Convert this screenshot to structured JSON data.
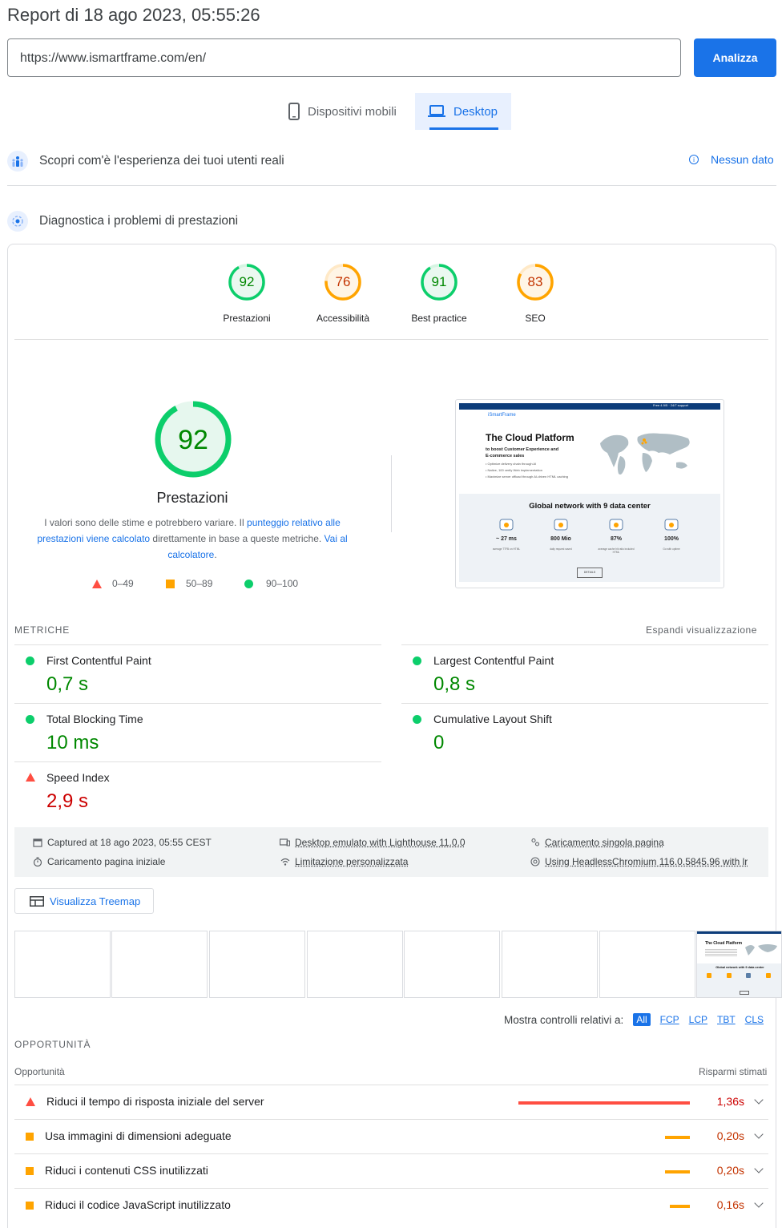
{
  "header": {
    "title": "Report di 18 ago 2023, 05:55:26",
    "url_value": "https://www.ismartframe.com/en/",
    "analyze_label": "Analizza"
  },
  "tabs": [
    {
      "label": "Dispositivi mobili",
      "icon": "phone-icon",
      "active": false
    },
    {
      "label": "Desktop",
      "icon": "laptop-icon",
      "active": true
    }
  ],
  "field_section": {
    "label": "Scopri com'è l'esperienza dei tuoi utenti reali",
    "status": "Nessun dato"
  },
  "lab_section": {
    "label": "Diagnostica i problemi di prestazioni"
  },
  "categories": [
    {
      "score": "92",
      "label": "Prestazioni",
      "level": 0.92,
      "color": "#0cce6b",
      "text_color": "#008800"
    },
    {
      "score": "76",
      "label": "Accessibilità",
      "level": 0.76,
      "color": "#ffa400",
      "text_color": "#c33300"
    },
    {
      "score": "91",
      "label": "Best practice",
      "level": 0.91,
      "color": "#0cce6b",
      "text_color": "#008800"
    },
    {
      "score": "83",
      "label": "SEO",
      "level": 0.83,
      "color": "#ffa400",
      "text_color": "#c33300"
    }
  ],
  "performance": {
    "score": "92",
    "level": 0.92,
    "label": "Prestazioni",
    "desc_1": "I valori sono delle stime e potrebbero variare. Il ",
    "desc_link_1": "punteggio relativo alle prestazioni viene calcolato",
    "desc_2": " direttamente in base a queste metriche. ",
    "desc_link_2": "Vai al calcolatore",
    "desc_end": ".",
    "legend": [
      "0–49",
      "50–89",
      "90–100"
    ]
  },
  "screenshot": {
    "brand": "iSmartFrame",
    "topbar_text": "Free 4.9/5 · 24/7 support",
    "headline": "The Cloud Platform",
    "sub_1": "to boost Customer Experience and",
    "sub_2": "E-commerce sales",
    "bullet_1": "• Optimize delivery chain through AI",
    "bullet_2": "• Native, 100 verify Web implementation",
    "bullet_3": "• Maximize server offload through AI-driven HTML caching",
    "network_title": "Global network with 9 data center",
    "stats": [
      {
        "value": "~ 27 ms",
        "caption": "average TTFB on HTML"
      },
      {
        "value": "800 Mio",
        "caption": "daily request saved"
      },
      {
        "value": "87%",
        "caption": "average cache hit ratio included HTML"
      },
      {
        "value": "100%",
        "caption": "Go with uptime"
      }
    ],
    "button": "DETAILS"
  },
  "metrics": {
    "heading": "METRICHE",
    "expand": "Espandi visualizzazione",
    "items": [
      {
        "name": "First Contentful Paint",
        "value": "0,7 s",
        "status": "good"
      },
      {
        "name": "Largest Contentful Paint",
        "value": "0,8 s",
        "status": "good"
      },
      {
        "name": "Total Blocking Time",
        "value": "10 ms",
        "status": "good"
      },
      {
        "name": "Cumulative Layout Shift",
        "value": "0",
        "status": "good"
      },
      {
        "name": "Speed Index",
        "value": "2,9 s",
        "status": "poor"
      }
    ]
  },
  "run_info": {
    "captured": "Captured at 18 ago 2023, 05:55 CEST",
    "initial_load": "Caricamento pagina iniziale",
    "emulated": "Desktop emulato with Lighthouse 11.0.0",
    "throttling": "Limitazione personalizzata",
    "single_load": "Caricamento singola pagina",
    "browser": "Using HeadlessChromium 116.0.5845.96 with lr"
  },
  "treemap_label": "Visualizza Treemap",
  "filter": {
    "label": "Mostra controlli relativi a:",
    "chips": [
      "All",
      "FCP",
      "LCP",
      "TBT",
      "CLS"
    ]
  },
  "opportunities": {
    "heading": "OPPORTUNITÀ",
    "col_left": "Opportunità",
    "col_right": "Risparmi stimati",
    "items": [
      {
        "title": "Riduci il tempo di risposta iniziale del server",
        "value": "1,36s",
        "status": "poor",
        "fraction": 1.0
      },
      {
        "title": "Usa immagini di dimensioni adeguate",
        "value": "0,20s",
        "status": "average",
        "fraction": 0.147
      },
      {
        "title": "Riduci i contenuti CSS inutilizzati",
        "value": "0,20s",
        "status": "average",
        "fraction": 0.147
      },
      {
        "title": "Riduci il codice JavaScript inutilizzato",
        "value": "0,16s",
        "status": "average",
        "fraction": 0.118
      }
    ]
  }
}
